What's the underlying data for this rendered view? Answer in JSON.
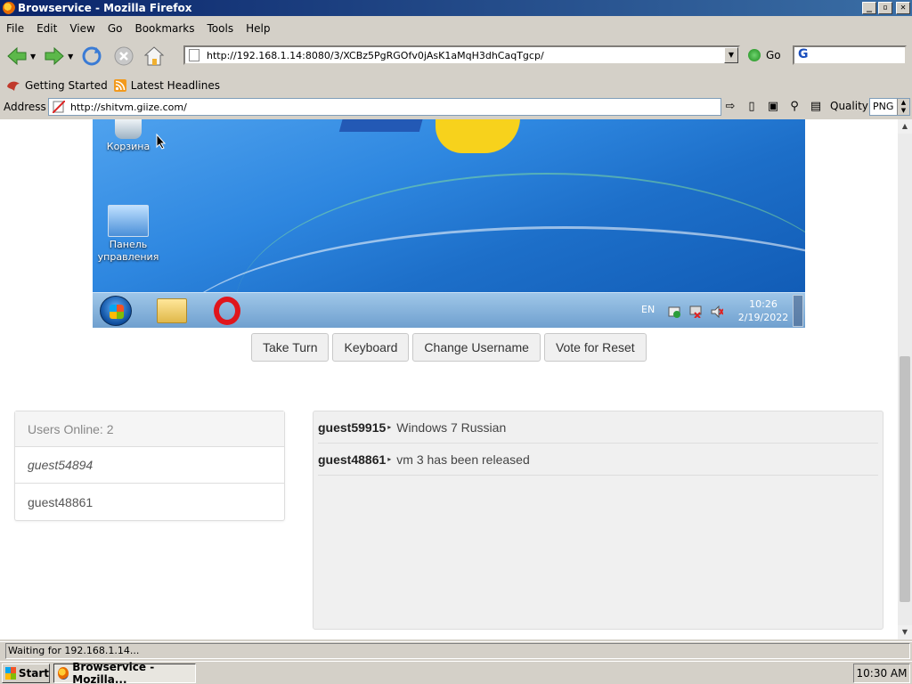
{
  "window": {
    "title": "Browservice - Mozilla Firefox"
  },
  "menu": [
    "File",
    "Edit",
    "View",
    "Go",
    "Bookmarks",
    "Tools",
    "Help"
  ],
  "navbar": {
    "url": "http://192.168.1.14:8080/3/XCBz5PgRGOfv0jAsK1aMqH3dhCaqTgcp/",
    "go_label": "Go"
  },
  "bookmarks": {
    "items": [
      "Getting Started",
      "Latest Headlines"
    ]
  },
  "proxy": {
    "address_label": "Address",
    "address": "http://shitvm.giize.com/",
    "quality_label": "Quality",
    "quality_value": "PNG"
  },
  "vm": {
    "desktop_icons": [
      "Корзина",
      "Панель управления"
    ],
    "lang": "EN",
    "time": "10:26",
    "date": "2/19/2022"
  },
  "controls": [
    "Take Turn",
    "Keyboard",
    "Change Username",
    "Vote for Reset"
  ],
  "users": {
    "header": "Users Online: 2",
    "list": [
      "guest54894",
      "guest48861"
    ]
  },
  "chat": [
    {
      "name": "guest59915",
      "text": "Windows 7 Russian"
    },
    {
      "name": "guest48861",
      "text": "vm 3 has been released"
    }
  ],
  "status": "Waiting for 192.168.1.14...",
  "taskbar": {
    "start": "Start",
    "task": "Browservice - Mozilla...",
    "clock": "10:30 AM"
  }
}
